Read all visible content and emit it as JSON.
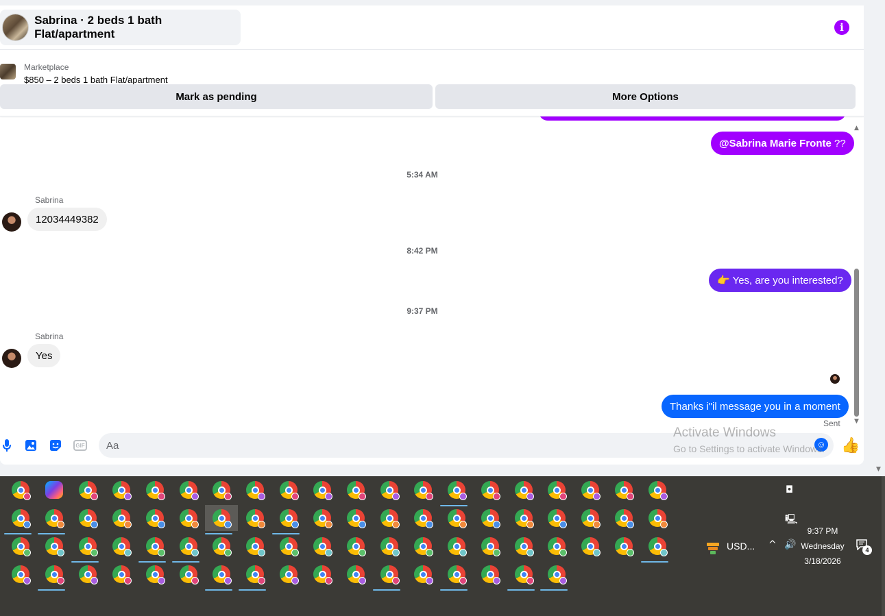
{
  "header": {
    "title": "Sabrina · 2 beds 1 bath Flat/apartment"
  },
  "marketplace": {
    "label": "Marketplace",
    "listing": "$850 – 2 beds 1 bath Flat/apartment",
    "pending_label": "Mark as pending",
    "more_label": "More Options"
  },
  "messages": {
    "mention_name": "@Sabrina Marie Fronte",
    "mention_suffix": " ??",
    "time1": "5:34 AM",
    "sender1": "Sabrina",
    "msg_phone": "12034449382",
    "time2": "8:42 PM",
    "msg_interested": "👉 Yes, are you interested?",
    "time3": "9:37 PM",
    "sender2": "Sabrina",
    "msg_yes": "Yes",
    "msg_thanks": "Thanks i\"il message you in a moment",
    "sent_label": "Sent"
  },
  "composer": {
    "placeholder": "Aa"
  },
  "watermark": {
    "line1": "Activate Windows",
    "line2": "Go to Settings to activate Windows."
  },
  "taskbar": {
    "currency": "USD...",
    "time": "9:37 PM",
    "day": "Wednesday",
    "date": "3/18/2026",
    "notifications": "4"
  },
  "colors": {
    "accent_purple": "#a100ff",
    "accent_violet": "#6a28f0",
    "accent_blue": "#0866ff",
    "taskbar_bg": "#3b3a36"
  },
  "icons": [
    "info-icon",
    "microphone-icon",
    "photo-icon",
    "sticker-icon",
    "gif-icon",
    "emoji-icon",
    "thumbs-up-icon",
    "chrome-icon",
    "copilot-icon",
    "camera-icon",
    "network-icon",
    "volume-icon",
    "chevron-up-icon",
    "notification-icon"
  ]
}
